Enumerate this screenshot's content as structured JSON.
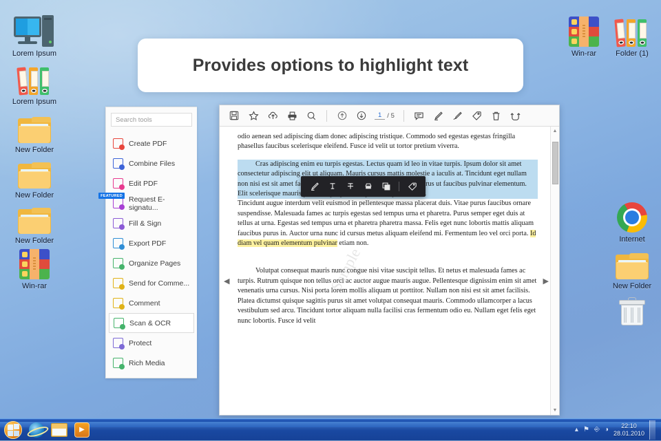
{
  "banner": {
    "text": "Provides options to highlight text"
  },
  "desktop": {
    "left_icons": [
      {
        "label": "Lorem Ipsum",
        "icon": "computer-monitor-icon",
        "type": "monitor"
      },
      {
        "label": "Lorem Ipsum",
        "icon": "binders-icon",
        "type": "binders"
      },
      {
        "label": "New Folder",
        "icon": "folder-icon",
        "type": "folder"
      },
      {
        "label": "New Folder",
        "icon": "folder-icon",
        "type": "folder"
      },
      {
        "label": "New Folder",
        "icon": "folder-icon",
        "type": "folder"
      },
      {
        "label": "Win-rar",
        "icon": "winrar-icon",
        "type": "winrar"
      }
    ],
    "right_icons": [
      {
        "label": "Win-rar",
        "icon": "winrar-icon",
        "type": "winrar"
      },
      {
        "label": "Folder (1)",
        "icon": "binders-icon",
        "type": "binders"
      },
      {
        "label": "Internet",
        "icon": "chrome-icon",
        "type": "chrome"
      },
      {
        "label": "New Folder",
        "icon": "folder-icon",
        "type": "folder"
      },
      {
        "label": "",
        "icon": "recycle-bin-icon",
        "type": "trash"
      }
    ]
  },
  "tools_panel": {
    "search": {
      "placeholder": "Search tools",
      "value": ""
    },
    "items": [
      {
        "label": "Create PDF",
        "icon": "create-pdf-icon",
        "color": "#e8453c",
        "badge": "",
        "selected": false
      },
      {
        "label": "Combine Files",
        "icon": "combine-files-icon",
        "color": "#3d63d8",
        "badge": "",
        "selected": false
      },
      {
        "label": "Edit PDF",
        "icon": "edit-pdf-icon",
        "color": "#e8398f",
        "badge": "",
        "selected": false
      },
      {
        "label": "Request E-signatu...",
        "icon": "request-esignature-icon",
        "color": "#a83fd4",
        "badge": "FEATURED",
        "selected": false
      },
      {
        "label": "Fill & Sign",
        "icon": "fill-and-sign-icon",
        "color": "#8b5ad6",
        "badge": "",
        "selected": false
      },
      {
        "label": "Export PDF",
        "icon": "export-pdf-icon",
        "color": "#2f8ed6",
        "badge": "",
        "selected": false
      },
      {
        "label": "Organize Pages",
        "icon": "organize-pages-icon",
        "color": "#45b36b",
        "badge": "",
        "selected": false
      },
      {
        "label": "Send for Comme...",
        "icon": "send-for-comments-icon",
        "color": "#e0b217",
        "badge": "",
        "selected": false
      },
      {
        "label": "Comment",
        "icon": "comment-icon",
        "color": "#e0b217",
        "badge": "",
        "selected": false
      },
      {
        "label": "Scan & OCR",
        "icon": "scan-and-ocr-icon",
        "color": "#45b36b",
        "badge": "",
        "selected": true
      },
      {
        "label": "Protect",
        "icon": "protect-shield-icon",
        "color": "#7d6ad6",
        "badge": "",
        "selected": false
      },
      {
        "label": "Rich Media",
        "icon": "rich-media-icon",
        "color": "#45b36b",
        "badge": "",
        "selected": false
      }
    ]
  },
  "pdf_toolbar": {
    "buttons_left": [
      {
        "name": "save-icon",
        "glyph": "Ὃe"
      },
      {
        "name": "star-bookmark-icon",
        "glyph": "☆"
      },
      {
        "name": "upload-cloud-icon",
        "glyph": "☁"
      },
      {
        "name": "print-icon",
        "glyph": "⎙"
      },
      {
        "name": "zoom-search-icon",
        "glyph": "⌕"
      }
    ],
    "page_prev": "↑",
    "page_next": "↓",
    "page_current": "1",
    "page_total": "/ 5",
    "buttons_right": [
      {
        "name": "comment-balloon-icon",
        "glyph": "὞9"
      },
      {
        "name": "highlight-pen-icon",
        "glyph": "✎"
      },
      {
        "name": "signature-icon",
        "glyph": "✐"
      },
      {
        "name": "stamp-icon",
        "glyph": "Ἷ7"
      },
      {
        "name": "delete-trash-icon",
        "glyph": "Ὕ1"
      },
      {
        "name": "rotate-icon",
        "glyph": "↺"
      }
    ]
  },
  "context_toolbar": {
    "buttons": [
      {
        "name": "highlight-marker-icon",
        "glyph": "✎"
      },
      {
        "name": "underline-text-icon",
        "glyph": "T"
      },
      {
        "name": "strikethrough-text-icon",
        "glyph": "T"
      },
      {
        "name": "highlight-color-icon",
        "glyph": "▬"
      },
      {
        "name": "copy-icon",
        "glyph": "❐"
      },
      {
        "name": "add-note-tag-icon",
        "glyph": "Ἷ7"
      }
    ]
  },
  "document": {
    "watermark": "Sample",
    "paragraph_top": "odio aenean sed adipiscing diam donec adipiscing tristique. Commodo sed egestas egestas fringilla phasellus faucibus scelerisque eleifend. Fusce id velit ut tortor pretium viverra.",
    "paragraph_selected_head": "Cras adipiscing enim eu turpis egestas. Lectus quam id leo in vitae turpis. Ipsum dolor sit amet consectetur adipiscing elit ut aliquam. Mauris cursus mattis molestie a iaculis at. Tincidunt eget nullam non nisi est sit amet facilisis. Velit aliquet sagittis id consectetur purus ut faucibus pulvinar elementum. Elit scelerisque mauris pellentesque pulvinar pellentesque habitant.",
    "paragraph_selected_tail": " Tincidunt augue interdum velit euismod in pellentesque massa placerat duis. Vitae purus faucibus ornare suspendisse. Malesuada fames ac turpis egestas sed tempus urna et pharetra. Purus semper eget duis at tellus at urna. Egestas sed tempus urna et pharetra pharetra massa. Felis eget nunc lobortis mattis aliquam faucibus purus in. Auctor urna nunc id cursus metus aliquam eleifend mi. Fermentum leo vel orci porta. ",
    "highlight_yellow": "Id diam vel quam elementum pulvinar",
    "paragraph_after_highlight": " etiam non.",
    "paragraph_bottom": "Volutpat consequat mauris nunc congue nisi vitae suscipit tellus. Et   netus et malesuada fames ac turpis. Rutrum quisque non tellus orci ac auctor augue mauris augue. Pellentesque dignissim enim sit amet venenatis urna cursus. Nisi porta lorem mollis aliquam ut porttitor. Nullam non nisi est sit amet facilisis. Platea dictumst quisque sagittis purus sit amet volutpat consequat mauris. Commodo ullamcorper a lacus vestibulum sed arcu. Tincidunt tortor aliquam nulla facilisi cras fermentum odio eu. Nullam eget felis eget nunc lobortis. Fusce id velit"
  },
  "taskbar": {
    "start": "start-orb",
    "pinned": [
      {
        "name": "internet-explorer-icon"
      },
      {
        "name": "windows-explorer-icon"
      },
      {
        "name": "media-player-icon"
      }
    ],
    "tray_icons": [
      "▴",
      "⚑",
      "⌗",
      "◑"
    ],
    "time": "22:10",
    "date": "28.01.2010"
  },
  "colors": {
    "selection_blue": "#bcdcf0",
    "highlight_yellow": "#fdf19f",
    "accent_blue": "#1473e6",
    "taskbar_blue": "#1a4aa4"
  }
}
